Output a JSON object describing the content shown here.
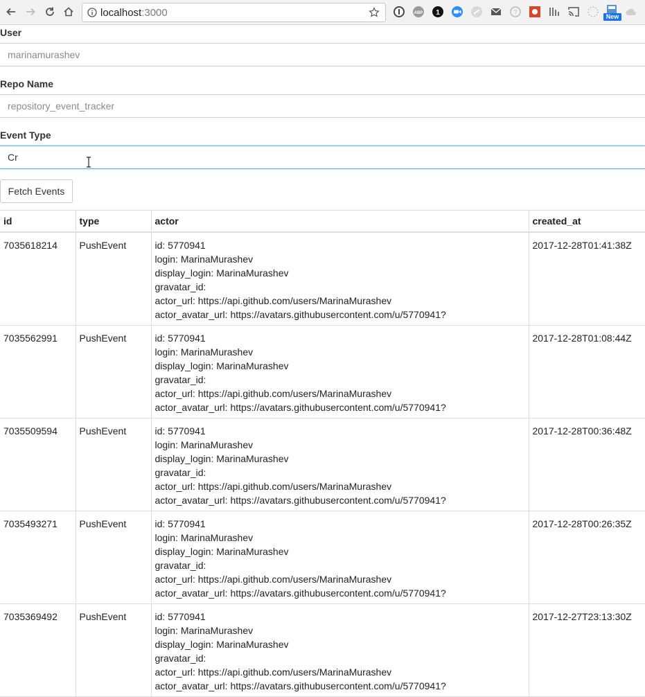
{
  "browser": {
    "url_host": "localhost",
    "url_port": ":3000",
    "new_badge": "New"
  },
  "form": {
    "user_label": "User",
    "user_placeholder": "marinamurashev",
    "repo_label": "Repo Name",
    "repo_placeholder": "repository_event_tracker",
    "event_type_label": "Event Type",
    "event_type_value": "Cr",
    "fetch_button": "Fetch Events"
  },
  "table": {
    "headers": [
      "id",
      "type",
      "actor",
      "created_at"
    ],
    "rows": [
      {
        "id": "7035618214",
        "type": "PushEvent",
        "actor": [
          "id: 5770941",
          "login: MarinaMurashev",
          "display_login: MarinaMurashev",
          "gravatar_id:",
          "actor_url: https://api.github.com/users/MarinaMurashev",
          "actor_avatar_url: https://avatars.githubusercontent.com/u/5770941?"
        ],
        "created_at": "2017-12-28T01:41:38Z"
      },
      {
        "id": "7035562991",
        "type": "PushEvent",
        "actor": [
          "id: 5770941",
          "login: MarinaMurashev",
          "display_login: MarinaMurashev",
          "gravatar_id:",
          "actor_url: https://api.github.com/users/MarinaMurashev",
          "actor_avatar_url: https://avatars.githubusercontent.com/u/5770941?"
        ],
        "created_at": "2017-12-28T01:08:44Z"
      },
      {
        "id": "7035509594",
        "type": "PushEvent",
        "actor": [
          "id: 5770941",
          "login: MarinaMurashev",
          "display_login: MarinaMurashev",
          "gravatar_id:",
          "actor_url: https://api.github.com/users/MarinaMurashev",
          "actor_avatar_url: https://avatars.githubusercontent.com/u/5770941?"
        ],
        "created_at": "2017-12-28T00:36:48Z"
      },
      {
        "id": "7035493271",
        "type": "PushEvent",
        "actor": [
          "id: 5770941",
          "login: MarinaMurashev",
          "display_login: MarinaMurashev",
          "gravatar_id:",
          "actor_url: https://api.github.com/users/MarinaMurashev",
          "actor_avatar_url: https://avatars.githubusercontent.com/u/5770941?"
        ],
        "created_at": "2017-12-28T00:26:35Z"
      },
      {
        "id": "7035369492",
        "type": "PushEvent",
        "actor": [
          "id: 5770941",
          "login: MarinaMurashev",
          "display_login: MarinaMurashev",
          "gravatar_id:",
          "actor_url: https://api.github.com/users/MarinaMurashev",
          "actor_avatar_url: https://avatars.githubusercontent.com/u/5770941?"
        ],
        "created_at": "2017-12-27T23:13:30Z"
      }
    ]
  }
}
